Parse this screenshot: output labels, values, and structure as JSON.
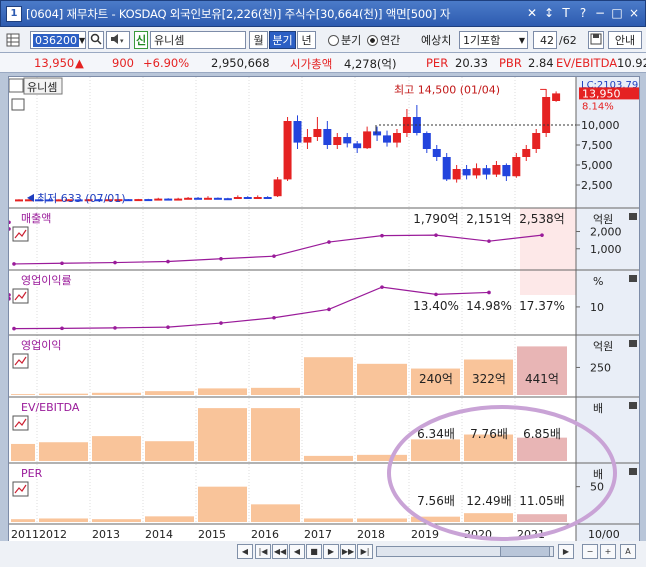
{
  "window": {
    "number": "1",
    "title": "[0604] 재무차트 - KOSDAQ 외국인보유[2,226(천)] 주식수[30,664(천)] 액면[500] 자",
    "buttons": [
      "✕",
      "↕",
      "T",
      "?",
      "−",
      "□",
      "×"
    ]
  },
  "toolbar": {
    "code": "036200",
    "badge": "신",
    "name": "유니셈",
    "period_month": "월",
    "period_quarter": "분기",
    "period_year": "년",
    "radio_quarter": "분기",
    "radio_annual": "연간",
    "forecast_label": "예상치",
    "forecast_select": "1기포함",
    "page": "42",
    "page_total": "/62",
    "guide": "안내"
  },
  "info": {
    "price": "13,950",
    "change": "900",
    "change_pct": "+6.90%",
    "volume": "2,950,668",
    "mcap_label": "시가총액",
    "mcap": "4,278(억)",
    "per_label": "PER",
    "per": "20.33",
    "pbr_label": "PBR",
    "pbr": "2.84",
    "ev_label": "EV/EBITDA",
    "ev": "10.92"
  },
  "colors": {
    "up": "#e52222",
    "down": "#2244dd",
    "bar": "#f9c49a",
    "bar_hl": "#e8b5b5",
    "line": "#9a1b9a",
    "label": "#9a1b9a",
    "ellipse": "#c9a3d6"
  },
  "chart_data": [
    {
      "type": "candlestick",
      "title": "유니셈",
      "yticks": [
        2500,
        5000,
        7500,
        10000
      ],
      "ylim": [
        0,
        15500
      ],
      "price_tag": "13,950",
      "lc_label": "LC:2103.79",
      "pct_label": "8.14%",
      "high_annotation": "최고 14,500 (01/04)",
      "low_annotation": "최저 633 (07/01)",
      "candles": [
        {
          "o": 700,
          "c": 700,
          "h": 720,
          "l": 680
        },
        {
          "o": 700,
          "c": 710,
          "h": 730,
          "l": 690
        },
        {
          "o": 710,
          "c": 700,
          "h": 730,
          "l": 680
        },
        {
          "o": 700,
          "c": 690,
          "h": 710,
          "l": 670
        },
        {
          "o": 690,
          "c": 700,
          "h": 720,
          "l": 680
        },
        {
          "o": 700,
          "c": 710,
          "h": 730,
          "l": 690
        },
        {
          "o": 700,
          "c": 690,
          "h": 710,
          "l": 670
        },
        {
          "o": 700,
          "c": 720,
          "h": 740,
          "l": 690
        },
        {
          "o": 720,
          "c": 700,
          "h": 740,
          "l": 680
        },
        {
          "o": 700,
          "c": 720,
          "h": 740,
          "l": 690
        },
        {
          "o": 720,
          "c": 730,
          "h": 760,
          "l": 700
        },
        {
          "o": 730,
          "c": 720,
          "h": 750,
          "l": 700
        },
        {
          "o": 720,
          "c": 740,
          "h": 760,
          "l": 700
        },
        {
          "o": 740,
          "c": 720,
          "h": 770,
          "l": 700
        },
        {
          "o": 700,
          "c": 800,
          "h": 900,
          "l": 650
        },
        {
          "o": 800,
          "c": 720,
          "h": 850,
          "l": 700
        },
        {
          "o": 720,
          "c": 800,
          "h": 900,
          "l": 680
        },
        {
          "o": 800,
          "c": 900,
          "h": 1000,
          "l": 750
        },
        {
          "o": 900,
          "c": 850,
          "h": 1000,
          "l": 800
        },
        {
          "o": 850,
          "c": 900,
          "h": 1100,
          "l": 800
        },
        {
          "o": 900,
          "c": 850,
          "h": 950,
          "l": 800
        },
        {
          "o": 850,
          "c": 800,
          "h": 900,
          "l": 750
        },
        {
          "o": 800,
          "c": 1000,
          "h": 1200,
          "l": 750
        },
        {
          "o": 1000,
          "c": 900,
          "h": 1100,
          "l": 850
        },
        {
          "o": 900,
          "c": 1000,
          "h": 1200,
          "l": 850
        },
        {
          "o": 1000,
          "c": 950,
          "h": 1100,
          "l": 900
        },
        {
          "o": 1100,
          "c": 3200,
          "h": 3500,
          "l": 1000
        },
        {
          "o": 3200,
          "c": 10500,
          "h": 11000,
          "l": 3000
        },
        {
          "o": 10500,
          "c": 7800,
          "h": 11200,
          "l": 7000
        },
        {
          "o": 7800,
          "c": 8500,
          "h": 9500,
          "l": 7000
        },
        {
          "o": 8500,
          "c": 9500,
          "h": 11000,
          "l": 8000
        },
        {
          "o": 9500,
          "c": 7500,
          "h": 10500,
          "l": 7000
        },
        {
          "o": 7500,
          "c": 8500,
          "h": 9000,
          "l": 7000
        },
        {
          "o": 8500,
          "c": 7700,
          "h": 9000,
          "l": 7200
        },
        {
          "o": 7700,
          "c": 7100,
          "h": 8000,
          "l": 6500
        },
        {
          "o": 7100,
          "c": 9200,
          "h": 9800,
          "l": 7000
        },
        {
          "o": 9200,
          "c": 8700,
          "h": 9800,
          "l": 8000
        },
        {
          "o": 8700,
          "c": 7800,
          "h": 9300,
          "l": 7300
        },
        {
          "o": 7800,
          "c": 9000,
          "h": 9500,
          "l": 7200
        },
        {
          "o": 9000,
          "c": 11000,
          "h": 12000,
          "l": 8500
        },
        {
          "o": 11000,
          "c": 9000,
          "h": 12500,
          "l": 8700
        },
        {
          "o": 9000,
          "c": 7000,
          "h": 9200,
          "l": 6500
        },
        {
          "o": 7000,
          "c": 6000,
          "h": 7500,
          "l": 5500
        },
        {
          "o": 6000,
          "c": 3200,
          "h": 6500,
          "l": 3000
        },
        {
          "o": 3200,
          "c": 4500,
          "h": 5000,
          "l": 2800
        },
        {
          "o": 4500,
          "c": 3700,
          "h": 5000,
          "l": 3200
        },
        {
          "o": 3700,
          "c": 4600,
          "h": 5200,
          "l": 3300
        },
        {
          "o": 4600,
          "c": 3800,
          "h": 5000,
          "l": 3200
        },
        {
          "o": 3800,
          "c": 5000,
          "h": 5500,
          "l": 3500
        },
        {
          "o": 5000,
          "c": 3600,
          "h": 5200,
          "l": 3000
        },
        {
          "o": 3600,
          "c": 6000,
          "h": 6500,
          "l": 3400
        },
        {
          "o": 6000,
          "c": 7000,
          "h": 7500,
          "l": 5500
        },
        {
          "o": 7000,
          "c": 9000,
          "h": 9500,
          "l": 6500
        },
        {
          "o": 9000,
          "c": 13500,
          "h": 14500,
          "l": 8500
        },
        {
          "o": 13000,
          "c": 13950,
          "h": 14200,
          "l": 12900
        }
      ]
    },
    {
      "type": "line",
      "title": "매출액",
      "unit": "억원",
      "yticks": [
        1000,
        2000
      ],
      "ylim": [
        0,
        2900
      ],
      "values": [
        120,
        160,
        200,
        260,
        420,
        570,
        1390,
        1760,
        1790,
        1440,
        1790,
        2151,
        2538
      ],
      "labels": [
        "1,790억",
        "2,151억",
        "2,538억"
      ]
    },
    {
      "type": "line",
      "title": "영업이익률",
      "unit": "%",
      "yticks": [
        10
      ],
      "ylim": [
        0,
        22
      ],
      "values": [
        1.0,
        1.1,
        1.3,
        1.6,
        3.3,
        5.5,
        9.0,
        18.2,
        15.2,
        16.0,
        13.4,
        14.98
      ],
      "labels": [
        "13.40%",
        "14.98%",
        "17.37%"
      ]
    },
    {
      "type": "bar",
      "title": "영업이익",
      "unit": "억원",
      "yticks": [
        250
      ],
      "ylim": [
        0,
        490
      ],
      "values": [
        8,
        12,
        20,
        35,
        60,
        65,
        343,
        283,
        240,
        322,
        441
      ],
      "labels": [
        "240억",
        "322억",
        "441억"
      ]
    },
    {
      "type": "bar",
      "title": "EV/EBITDA",
      "unit": "배",
      "ylim": [
        0,
        17
      ],
      "values": [
        5.0,
        5.5,
        7.3,
        5.8,
        15.5,
        15.5,
        1.5,
        1.8,
        6.34,
        7.76,
        6.85
      ],
      "labels": [
        "6.34배",
        "7.76배",
        "6.85배"
      ]
    },
    {
      "type": "bar",
      "title": "PER",
      "unit": "배",
      "yticks": [
        50
      ],
      "ylim": [
        0,
        75
      ],
      "values": [
        4,
        5,
        4,
        8,
        50,
        25,
        5,
        5,
        7.56,
        12.49,
        11.05
      ],
      "labels": [
        "7.56배",
        "12.49배",
        "11.05배"
      ]
    }
  ],
  "x_axis": {
    "years": [
      "2011",
      "2012",
      "2013",
      "2014",
      "2015",
      "2016",
      "2017",
      "2018",
      "2019",
      "2020",
      "2021"
    ],
    "right_label": "10/00"
  },
  "controls": [
    "◀",
    "|◀",
    "◀◀",
    "◀",
    "■",
    "▶",
    "▶▶",
    "▶|",
    "▶",
    "−",
    "+",
    "A"
  ]
}
